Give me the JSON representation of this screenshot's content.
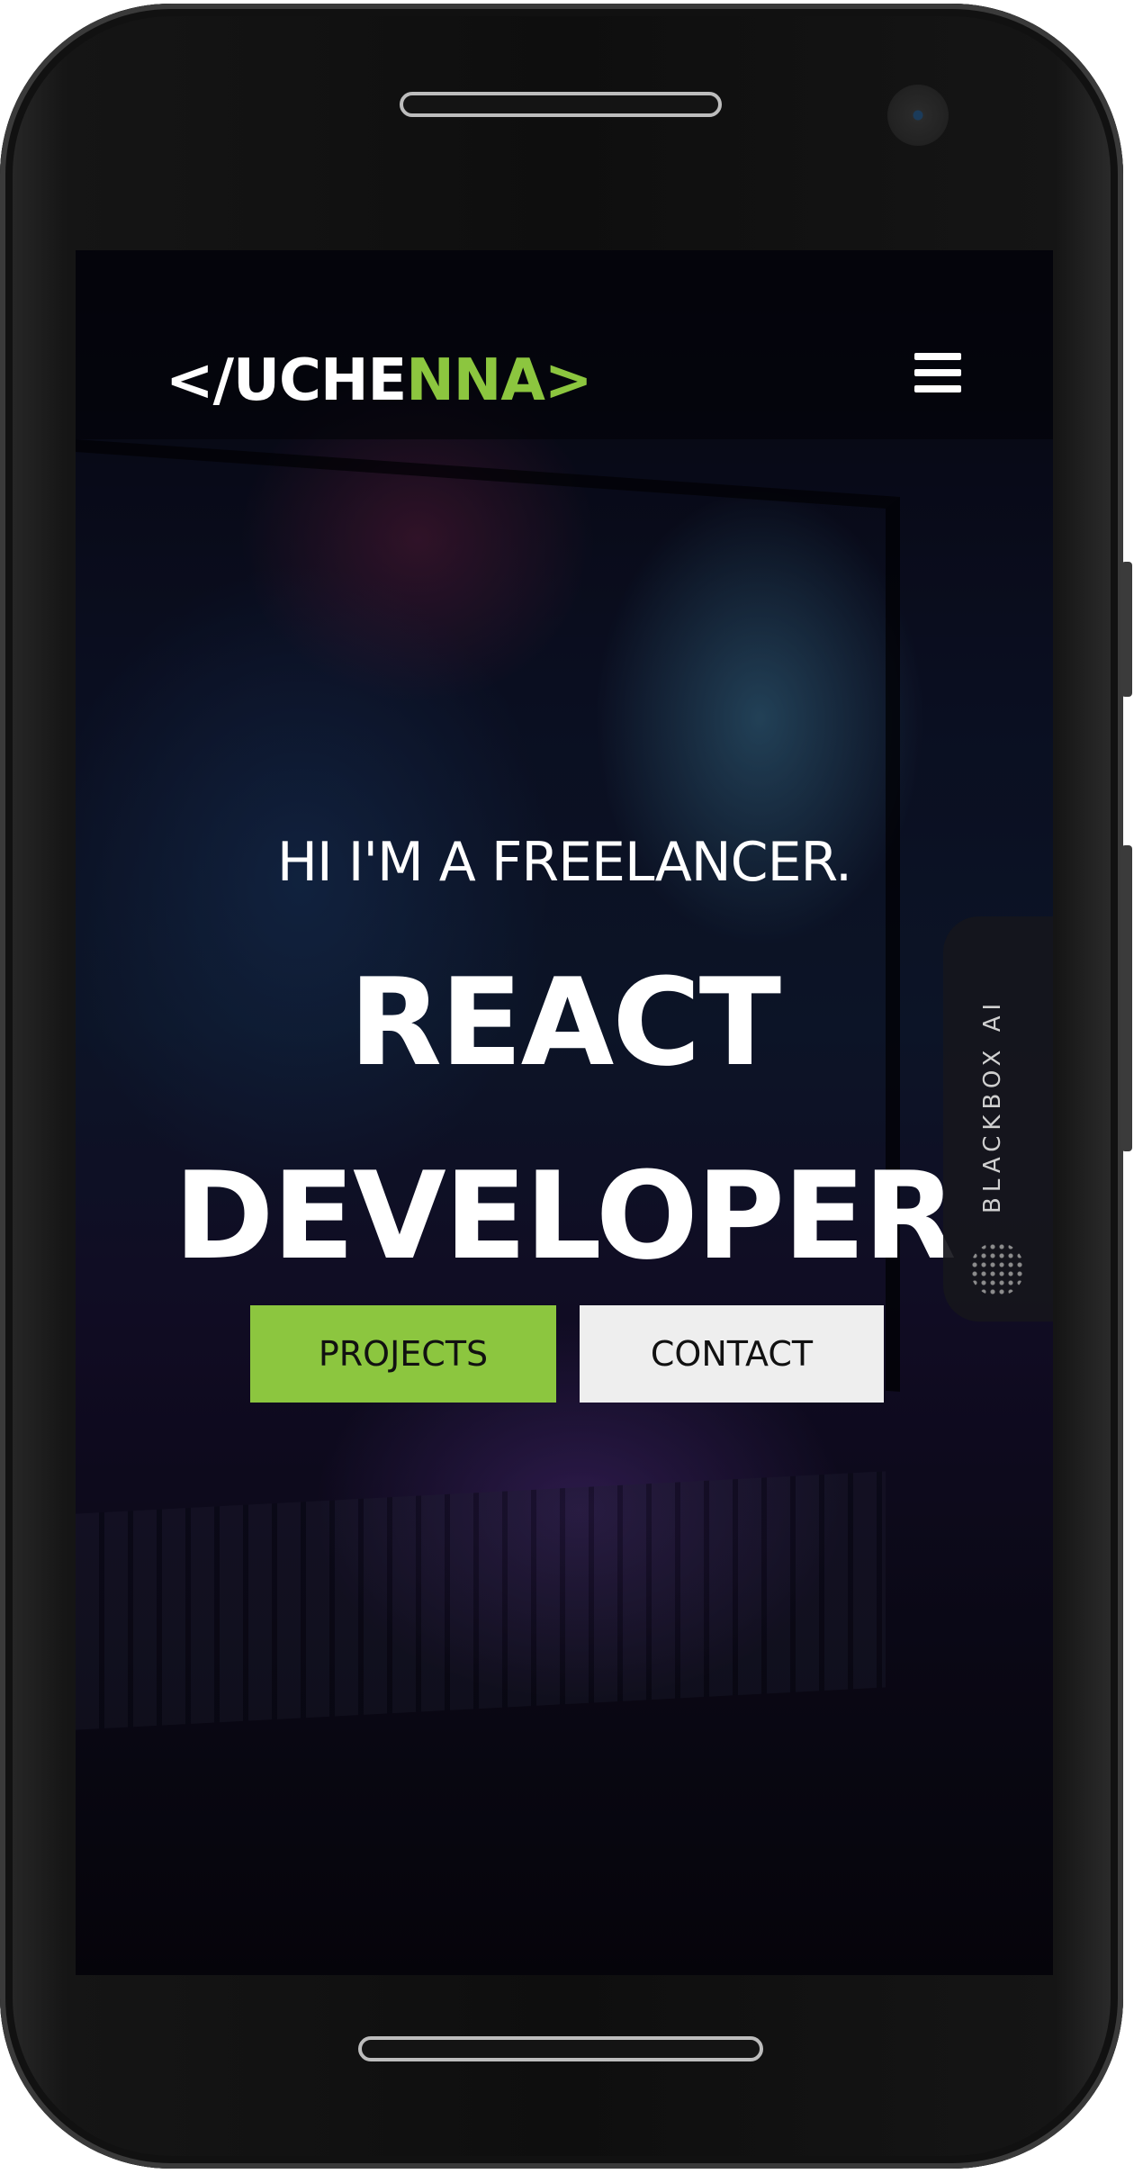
{
  "header": {
    "logo_prefix": "</UCHE",
    "logo_accent": "NNA",
    "logo_suffix": ">",
    "menu_icon": "hamburger-menu-icon"
  },
  "hero": {
    "subtitle": "HI I'M A FREELANCER.",
    "headline_line1": "REACT",
    "headline_line2": "DEVELOPER"
  },
  "buttons": {
    "projects_label": "PROJECTS",
    "contact_label": "CONTACT"
  },
  "side_tab": {
    "label": "BLACKBOX AI",
    "icon": "blackbox-dots-icon"
  },
  "colors": {
    "accent": "#8cc63f",
    "contact_bg": "#eeeeee",
    "text": "#ffffff"
  }
}
